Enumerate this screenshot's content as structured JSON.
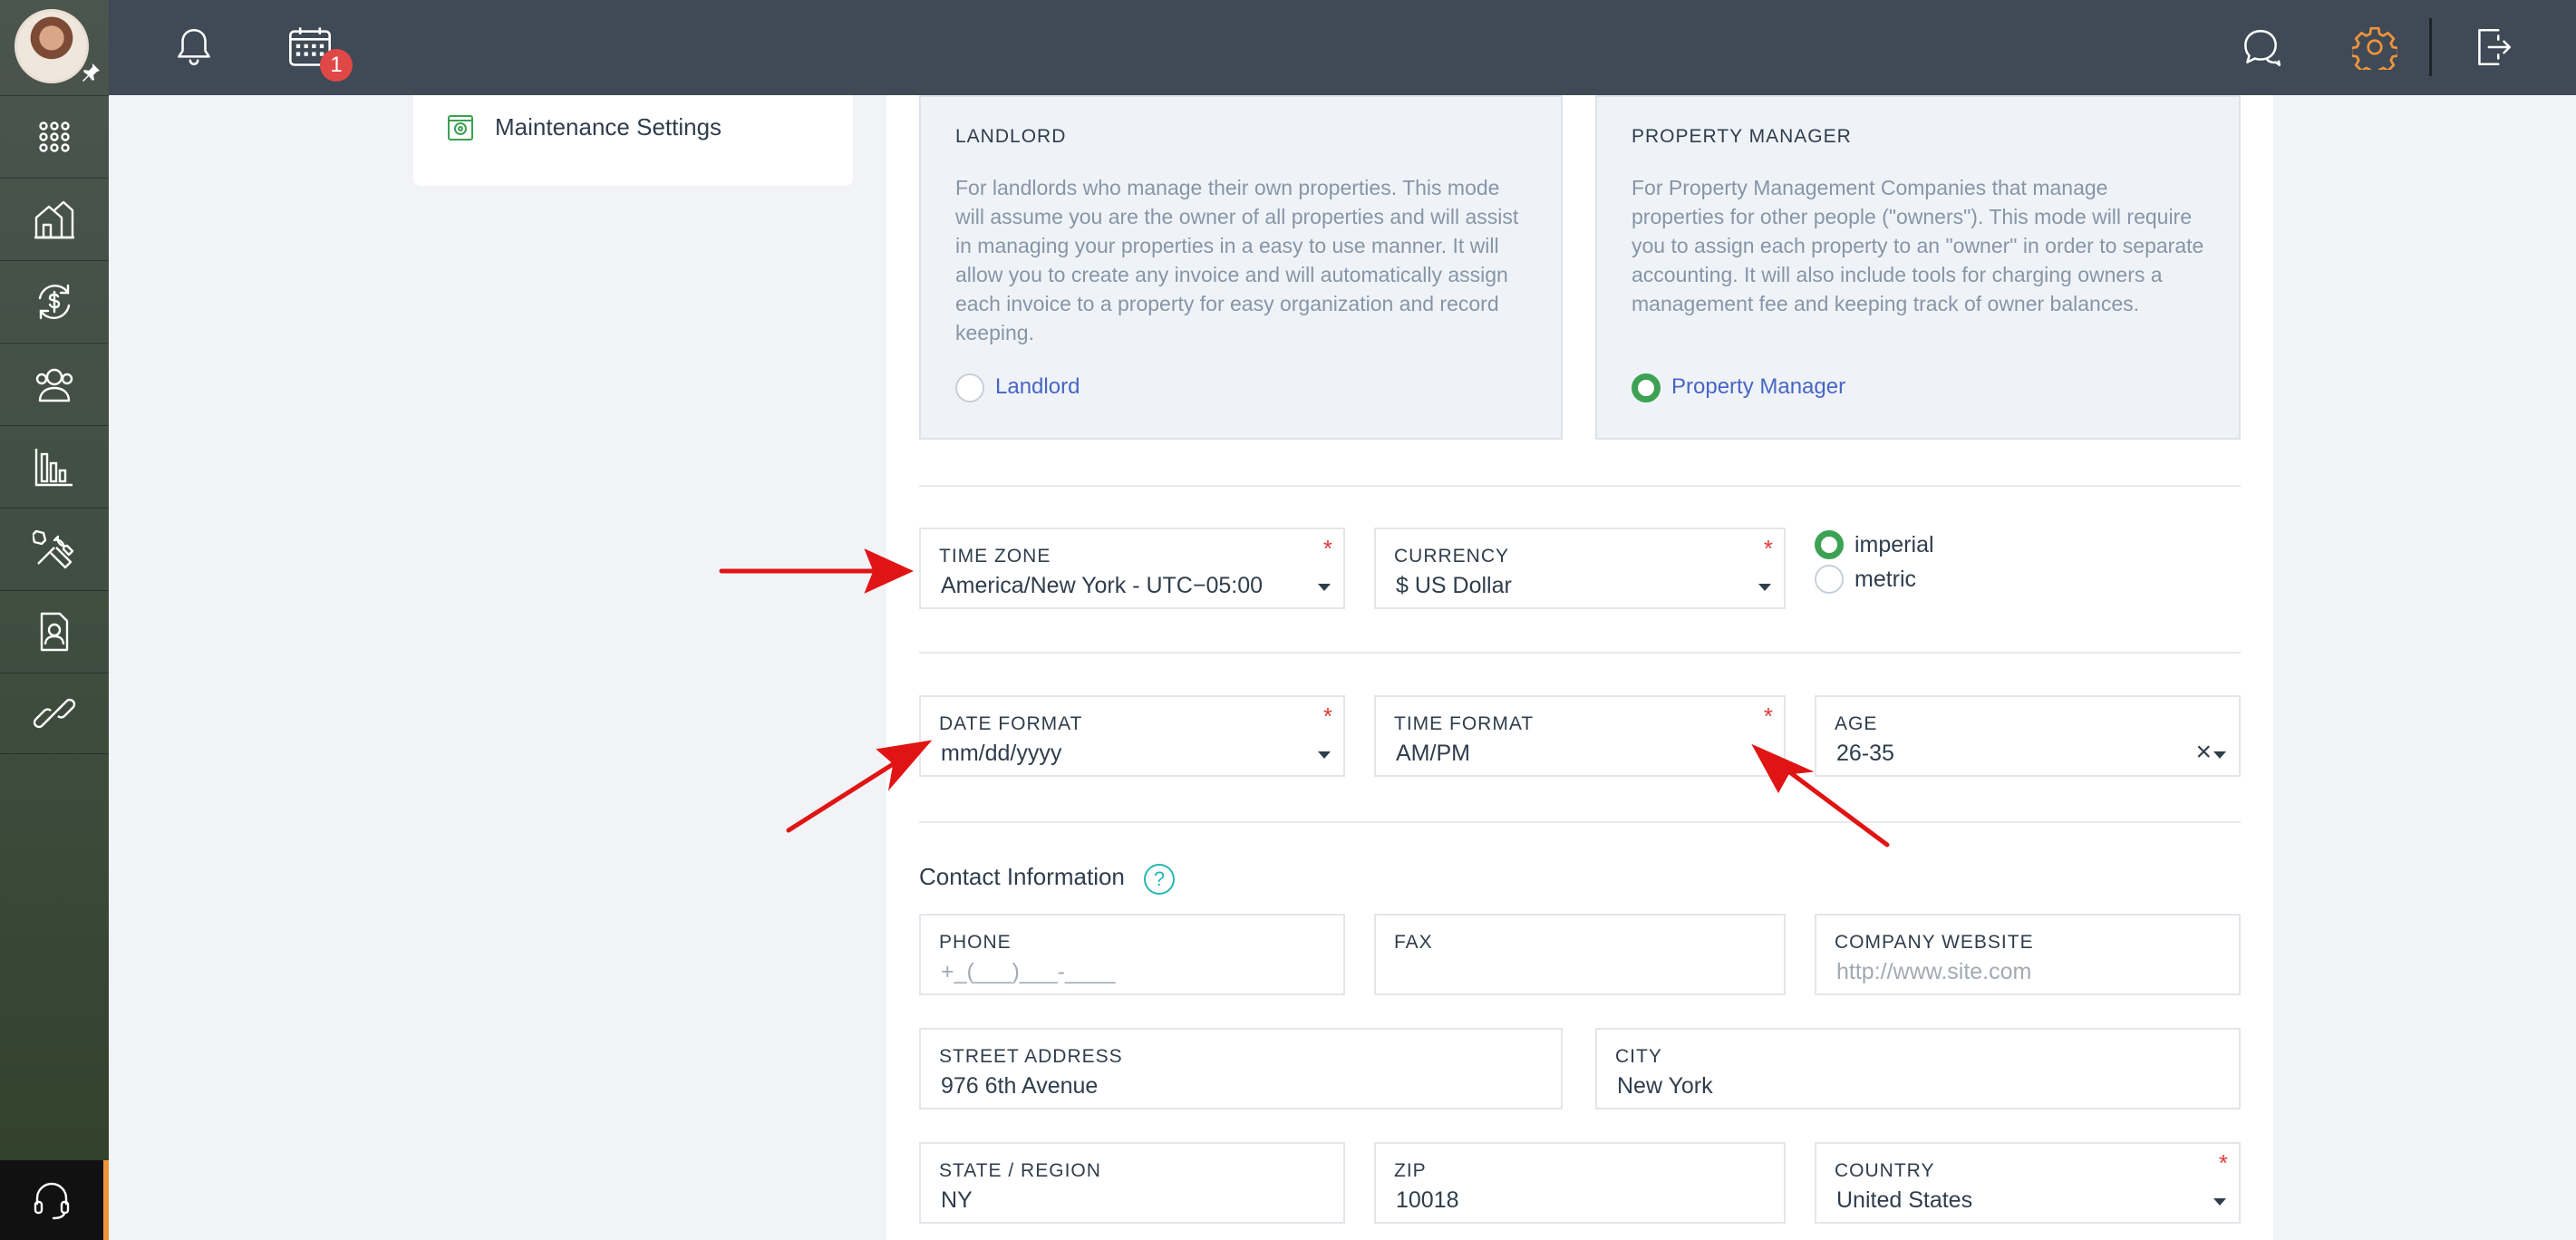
{
  "topbar": {
    "calendar_badge": "1",
    "icons": {
      "bell": "bell-icon",
      "calendar": "calendar-icon",
      "chat": "chat-icon",
      "settings": "gear-icon",
      "logout": "logout-icon"
    },
    "colors": {
      "bar": "#3f4a56",
      "settings_accent": "#f0943b",
      "badge": "#e04848"
    }
  },
  "sidebar": {
    "items": [
      {
        "icon": "apps-grid-icon"
      },
      {
        "icon": "properties-icon"
      },
      {
        "icon": "transactions-icon"
      },
      {
        "icon": "people-icon"
      },
      {
        "icon": "reports-icon"
      },
      {
        "icon": "maintenance-tools-icon"
      },
      {
        "icon": "tenant-portal-icon"
      },
      {
        "icon": "integrations-link-icon"
      }
    ],
    "support_icon": "headset-icon"
  },
  "settings_nav": {
    "item_label": "Maintenance Settings",
    "item_icon": "maintenance-settings-icon"
  },
  "mode": {
    "landlord": {
      "title": "LANDLORD",
      "description": "For landlords who manage their own properties. This mode will assume you are the owner of all properties and will assist in managing your properties in a easy to use manner. It will allow you to create any invoice and will automatically assign each invoice to a property for easy organization and record keeping.",
      "option_label": "Landlord",
      "selected": false
    },
    "property_manager": {
      "title": "PROPERTY MANAGER",
      "description": "For Property Management Companies that manage properties for other people (\"owners\"). This mode will require you to assign each property to an \"owner\" in order to separate accounting. It will also include tools for charging owners a management fee and keeping track of owner balances.",
      "option_label": "Property Manager",
      "selected": true
    }
  },
  "regional": {
    "time_zone": {
      "label": "TIME ZONE",
      "value": "America/New York - UTC−05:00",
      "required": "*"
    },
    "currency": {
      "label": "CURRENCY",
      "value": "$ US Dollar",
      "required": "*"
    },
    "units": [
      {
        "label": "imperial",
        "selected": true
      },
      {
        "label": "metric",
        "selected": false
      }
    ],
    "date_format": {
      "label": "DATE FORMAT",
      "value": "mm/dd/yyyy",
      "required": "*"
    },
    "time_format": {
      "label": "TIME FORMAT",
      "value": "AM/PM",
      "required": "*"
    },
    "age": {
      "label": "AGE",
      "value": "26-35",
      "clear": "×"
    }
  },
  "contact": {
    "title": "Contact Information",
    "help": "?",
    "phone": {
      "label": "PHONE",
      "value": "+_(___)___-____"
    },
    "fax": {
      "label": "FAX",
      "value": ""
    },
    "website": {
      "label": "COMPANY WEBSITE",
      "placeholder": "http://www.site.com"
    },
    "street": {
      "label": "STREET ADDRESS",
      "value": "976 6th Avenue"
    },
    "city": {
      "label": "CITY",
      "value": "New York"
    },
    "state": {
      "label": "STATE / REGION",
      "value": "NY"
    },
    "zip": {
      "label": "ZIP",
      "value": "10018"
    },
    "country": {
      "label": "COUNTRY",
      "value": "United States",
      "required": "*"
    }
  },
  "annotations": {
    "arrow_color": "#e01414"
  }
}
